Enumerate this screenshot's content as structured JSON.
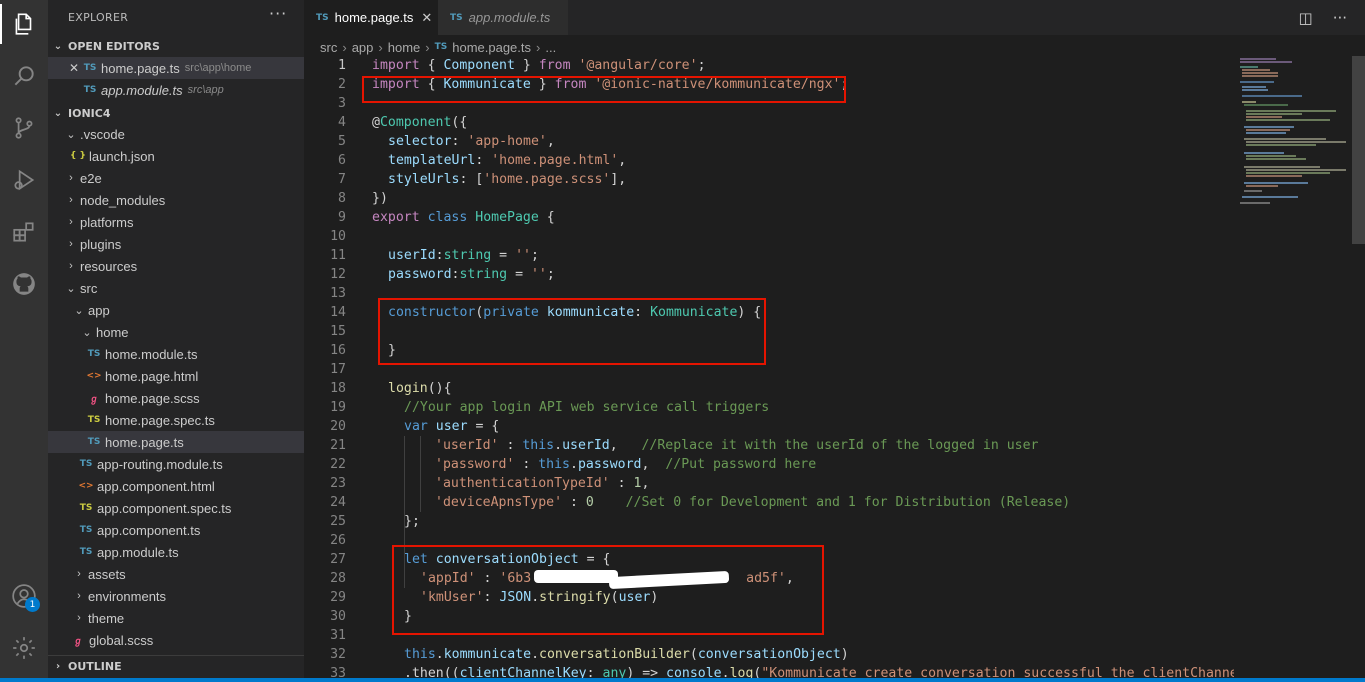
{
  "explorer": {
    "title": "EXPLORER",
    "more": "···",
    "open_editors": {
      "header": "OPEN EDITORS",
      "items": [
        {
          "name": "home.page.ts",
          "path": "src\\app\\home"
        },
        {
          "name": "app.module.ts",
          "path": "src\\app"
        }
      ]
    },
    "project": {
      "header": "IONIC4",
      "tree": [
        {
          "label": ".vscode"
        },
        {
          "label": "launch.json"
        },
        {
          "label": "e2e"
        },
        {
          "label": "node_modules"
        },
        {
          "label": "platforms"
        },
        {
          "label": "plugins"
        },
        {
          "label": "resources"
        },
        {
          "label": "src"
        },
        {
          "label": "app"
        },
        {
          "label": "home"
        },
        {
          "label": "home.module.ts"
        },
        {
          "label": "home.page.html"
        },
        {
          "label": "home.page.scss"
        },
        {
          "label": "home.page.spec.ts"
        },
        {
          "label": "home.page.ts"
        },
        {
          "label": "app-routing.module.ts"
        },
        {
          "label": "app.component.html"
        },
        {
          "label": "app.component.spec.ts"
        },
        {
          "label": "app.component.ts"
        },
        {
          "label": "app.module.ts"
        },
        {
          "label": "assets"
        },
        {
          "label": "environments"
        },
        {
          "label": "theme"
        },
        {
          "label": "global.scss"
        }
      ]
    },
    "outline_header": "OUTLINE"
  },
  "tabs": [
    {
      "label": "home.page.ts",
      "icon": "TS"
    },
    {
      "label": "app.module.ts",
      "icon": "TS"
    }
  ],
  "breadcrumb": [
    "src",
    "app",
    "home",
    "home.page.ts",
    "..."
  ],
  "account_badge": "1",
  "code_lines": [
    {
      "n": "1"
    },
    {
      "n": "2"
    },
    {
      "n": "3"
    },
    {
      "n": "4"
    },
    {
      "n": "5"
    },
    {
      "n": "6"
    },
    {
      "n": "7"
    },
    {
      "n": "8"
    },
    {
      "n": "9"
    },
    {
      "n": "10"
    },
    {
      "n": "11"
    },
    {
      "n": "12"
    },
    {
      "n": "13"
    },
    {
      "n": "14"
    },
    {
      "n": "15"
    },
    {
      "n": "16"
    },
    {
      "n": "17"
    },
    {
      "n": "18"
    },
    {
      "n": "19"
    },
    {
      "n": "20"
    },
    {
      "n": "21"
    },
    {
      "n": "22"
    },
    {
      "n": "23"
    },
    {
      "n": "24"
    },
    {
      "n": "25"
    },
    {
      "n": "26"
    },
    {
      "n": "27"
    },
    {
      "n": "28"
    },
    {
      "n": "29"
    },
    {
      "n": "30"
    },
    {
      "n": "31"
    },
    {
      "n": "32"
    },
    {
      "n": "33"
    }
  ],
  "code": {
    "l1": [
      "import",
      " { ",
      "Component",
      " } ",
      "from",
      " '@angular/core'",
      ";"
    ],
    "l2": [
      "import",
      " { ",
      "Kommunicate",
      " } ",
      "from",
      " '@ionic-native/kommunicate/ngx'",
      ";"
    ],
    "l4": [
      "@",
      "Component",
      "({"
    ],
    "l5": [
      "selector",
      ": ",
      "'app-home'",
      ","
    ],
    "l6": [
      "templateUrl",
      ": ",
      "'home.page.html'",
      ","
    ],
    "l7": [
      "styleUrls",
      ": [",
      "'home.page.scss'",
      "],"
    ],
    "l8": [
      "})"
    ],
    "l9": [
      "export",
      " ",
      "class",
      " ",
      "HomePage",
      " {"
    ],
    "l11": [
      "userId",
      ":",
      "string",
      " = ",
      "''",
      ";"
    ],
    "l12": [
      "password",
      ":",
      "string",
      " = ",
      "''",
      ";"
    ],
    "l14": [
      "constructor",
      "(",
      "private",
      " ",
      "kommunicate",
      ": ",
      "Kommunicate",
      ") {"
    ],
    "l16": [
      "}"
    ],
    "l18": [
      "login",
      "(){"
    ],
    "l19": [
      "//Your app login API web service call triggers"
    ],
    "l20": [
      "var",
      " ",
      "user",
      " = {"
    ],
    "l21": [
      "'userId'",
      " : ",
      "this",
      ".",
      "userId",
      ",   ",
      "//Replace it with the userId of the logged in user"
    ],
    "l22": [
      "'password'",
      " : ",
      "this",
      ".",
      "password",
      ",  ",
      "//Put password here"
    ],
    "l23": [
      "'authenticationTypeId'",
      " : ",
      "1",
      ","
    ],
    "l24": [
      "'deviceApnsType'",
      " : ",
      "0",
      "    ",
      "//Set 0 for Development and 1 for Distribution (Release)"
    ],
    "l25": [
      "};"
    ],
    "l27": [
      "let",
      " ",
      "conversationObject",
      " = {"
    ],
    "l28": [
      "'appId'",
      " : ",
      "'6b3",
      "ad5f'",
      ","
    ],
    "l29": [
      "'kmUser'",
      ": ",
      "JSON",
      ".",
      "stringify",
      "(",
      "user",
      ")"
    ],
    "l30": [
      "}"
    ],
    "l32": [
      "this",
      ".",
      "kommunicate",
      ".",
      "conversationBuilder",
      "(",
      "conversationObject",
      ")"
    ],
    "l33": [
      ".then((",
      "clientChannelKey",
      ": ",
      "any",
      ") => ",
      "console",
      ".",
      "log",
      "(",
      "\"Kommunicate create conversation successful the clientChannelKey"
    ]
  },
  "colors": {
    "keyword": "#569cd6",
    "control_keyword": "#c586c0",
    "class": "#4ec9b0",
    "string": "#ce9178",
    "variable": "#9cdcfe",
    "function": "#dcdcaa",
    "comment": "#6a9955",
    "highlight_box": "#e51400",
    "status_bar": "#007acc"
  }
}
